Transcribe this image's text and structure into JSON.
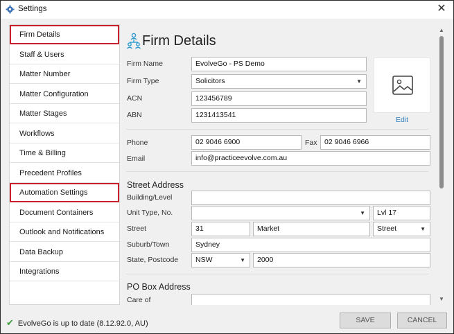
{
  "window": {
    "title": "Settings",
    "close_glyph": "✕"
  },
  "sidebar": {
    "items": [
      {
        "label": "Firm Details",
        "highlighted": true
      },
      {
        "label": "Staff & Users"
      },
      {
        "label": "Matter Number"
      },
      {
        "label": "Matter Configuration"
      },
      {
        "label": "Matter Stages"
      },
      {
        "label": "Workflows"
      },
      {
        "label": "Time & Billing"
      },
      {
        "label": "Precedent Profiles"
      },
      {
        "label": "Automation Settings",
        "highlighted": true
      },
      {
        "label": "Document Containers"
      },
      {
        "label": "Outlook and Notifications"
      },
      {
        "label": "Data Backup"
      },
      {
        "label": "Integrations"
      }
    ],
    "highlight_color": "#c8202c"
  },
  "main": {
    "title": "Firm Details",
    "title_icon": "organization-icon",
    "firm_name": {
      "label": "Firm Name",
      "value": "EvolveGo - PS Demo"
    },
    "firm_type": {
      "label": "Firm Type",
      "value": "Solicitors"
    },
    "acn": {
      "label": "ACN",
      "value": "123456789"
    },
    "abn": {
      "label": "ABN",
      "value": "1231413541"
    },
    "logo": {
      "icon": "image-placeholder-icon",
      "edit_label": "Edit"
    },
    "phone": {
      "label": "Phone",
      "value": "02 9046 6900"
    },
    "fax": {
      "label": "Fax",
      "value": "02 9046 6966"
    },
    "email": {
      "label": "Email",
      "value": "info@practiceevolve.com.au"
    },
    "street_address": {
      "title": "Street Address",
      "building_label": "Building/Level",
      "building_value": "",
      "unit_label": "Unit Type, No.",
      "unit_type_value": "",
      "unit_no_value": "Lvl 17",
      "street_label": "Street",
      "street_no_value": "31",
      "street_name_value": "Market",
      "street_type_value": "Street",
      "suburb_label": "Suburb/Town",
      "suburb_value": "Sydney",
      "state_label": "State, Postcode",
      "state_value": "NSW",
      "postcode_value": "2000"
    },
    "po_box": {
      "title": "PO Box Address",
      "care_of_label": "Care of"
    }
  },
  "status": {
    "text": "EvolveGo is up to date (8.12.92.0, AU)",
    "icon": "checkmark-icon"
  },
  "buttons": {
    "save": "SAVE",
    "cancel": "CANCEL"
  },
  "colors": {
    "accent": "#2f7fc1",
    "success": "#3a9b3a",
    "highlight": "#c8202c"
  }
}
